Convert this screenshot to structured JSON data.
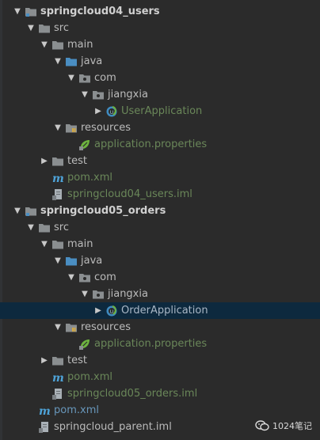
{
  "tree": {
    "items": [
      {
        "label": "springcloud04_users",
        "indent": 0,
        "arrow": "down",
        "icon": "module-folder",
        "style": "bold"
      },
      {
        "label": "src",
        "indent": 1,
        "arrow": "down",
        "icon": "folder",
        "style": "grey"
      },
      {
        "label": "main",
        "indent": 2,
        "arrow": "down",
        "icon": "folder",
        "style": "grey"
      },
      {
        "label": "java",
        "indent": 3,
        "arrow": "down",
        "icon": "source-folder",
        "style": "grey"
      },
      {
        "label": "com",
        "indent": 4,
        "arrow": "down",
        "icon": "package",
        "style": "grey"
      },
      {
        "label": "jiangxia",
        "indent": 5,
        "arrow": "down",
        "icon": "package",
        "style": "grey"
      },
      {
        "label": "UserApplication",
        "indent": 6,
        "arrow": "right",
        "icon": "spring-class",
        "style": "green"
      },
      {
        "label": "resources",
        "indent": 3,
        "arrow": "down",
        "icon": "resources-folder",
        "style": "grey"
      },
      {
        "label": "application.properties",
        "indent": 4,
        "arrow": "none",
        "icon": "spring-leaf",
        "style": "green"
      },
      {
        "label": "test",
        "indent": 2,
        "arrow": "right",
        "icon": "folder",
        "style": "grey"
      },
      {
        "label": "pom.xml",
        "indent": 2,
        "arrow": "none",
        "icon": "maven",
        "style": "green"
      },
      {
        "label": "springcloud04_users.iml",
        "indent": 2,
        "arrow": "none",
        "icon": "iml-file",
        "style": "green"
      },
      {
        "label": "springcloud05_orders",
        "indent": 0,
        "arrow": "down",
        "icon": "module-folder",
        "style": "bold"
      },
      {
        "label": "src",
        "indent": 1,
        "arrow": "down",
        "icon": "folder",
        "style": "grey"
      },
      {
        "label": "main",
        "indent": 2,
        "arrow": "down",
        "icon": "folder",
        "style": "grey"
      },
      {
        "label": "java",
        "indent": 3,
        "arrow": "down",
        "icon": "source-folder",
        "style": "grey"
      },
      {
        "label": "com",
        "indent": 4,
        "arrow": "down",
        "icon": "package",
        "style": "grey"
      },
      {
        "label": "jiangxia",
        "indent": 5,
        "arrow": "down",
        "icon": "package",
        "style": "grey"
      },
      {
        "label": "OrderApplication",
        "indent": 6,
        "arrow": "right",
        "icon": "spring-class",
        "style": "ordersel",
        "selected": true
      },
      {
        "label": "resources",
        "indent": 3,
        "arrow": "down",
        "icon": "resources-folder",
        "style": "grey"
      },
      {
        "label": "application.properties",
        "indent": 4,
        "arrow": "none",
        "icon": "spring-leaf",
        "style": "green"
      },
      {
        "label": "test",
        "indent": 2,
        "arrow": "right",
        "icon": "folder",
        "style": "grey"
      },
      {
        "label": "pom.xml",
        "indent": 2,
        "arrow": "none",
        "icon": "maven",
        "style": "green"
      },
      {
        "label": "springcloud05_orders.iml",
        "indent": 2,
        "arrow": "none",
        "icon": "iml-file",
        "style": "green"
      },
      {
        "label": "pom.xml",
        "indent": 1,
        "arrow": "none",
        "icon": "maven",
        "style": "blue"
      },
      {
        "label": "springcloud_parent.iml",
        "indent": 1,
        "arrow": "none",
        "icon": "iml-file",
        "style": "grey"
      }
    ]
  },
  "watermark": {
    "text": "1024笔记",
    "icon": "wechat-icon"
  },
  "colors": {
    "background": "#2b2b2b",
    "selection": "#0d293e",
    "folder": "#8a8e90",
    "source_folder": "#4a8ec2",
    "spring_green": "#6a8759",
    "maven_blue": "#4ea3d8"
  }
}
